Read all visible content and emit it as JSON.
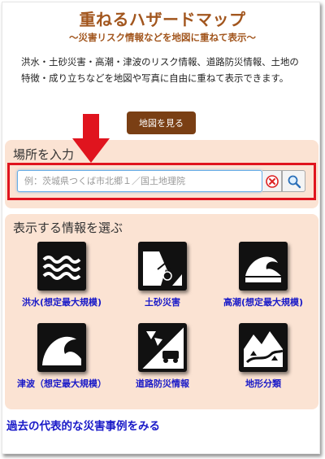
{
  "header": {
    "title": "重ねるハザードマップ",
    "subtitle": "〜災害リスク情報などを地図に重ねて表示〜"
  },
  "description": "洪水・土砂災害・高潮・津波のリスク情報、道路防災情報、土地の特徴・成り立ちなどを地図や写真に自由に重ねて表示できます。",
  "map_button": {
    "label": "地図を見る"
  },
  "place_search": {
    "heading": "場所を入力",
    "placeholder": "例：茨城県つくば市北郷１／国土地理院",
    "value": ""
  },
  "info_select": {
    "heading": "表示する情報を選ぶ",
    "items": [
      {
        "label": "洪水(想定最大規模)",
        "icon": "flood-icon"
      },
      {
        "label": "土砂災害",
        "icon": "landslide-icon"
      },
      {
        "label": "高潮(想定最大規模)",
        "icon": "storm-surge-icon"
      },
      {
        "label": "津波（想定最大規模）",
        "icon": "tsunami-icon"
      },
      {
        "label": "道路防災情報",
        "icon": "road-disaster-icon"
      },
      {
        "label": "地形分類",
        "icon": "landform-icon"
      }
    ]
  },
  "bottom_link": {
    "label": "過去の代表的な災害事例をみる"
  },
  "colors": {
    "title": "#a2561e",
    "map_button": "#7a3f14",
    "panel_bg": "#fbe3d3",
    "highlight": "#e0141e",
    "link": "#1a1ac8"
  }
}
